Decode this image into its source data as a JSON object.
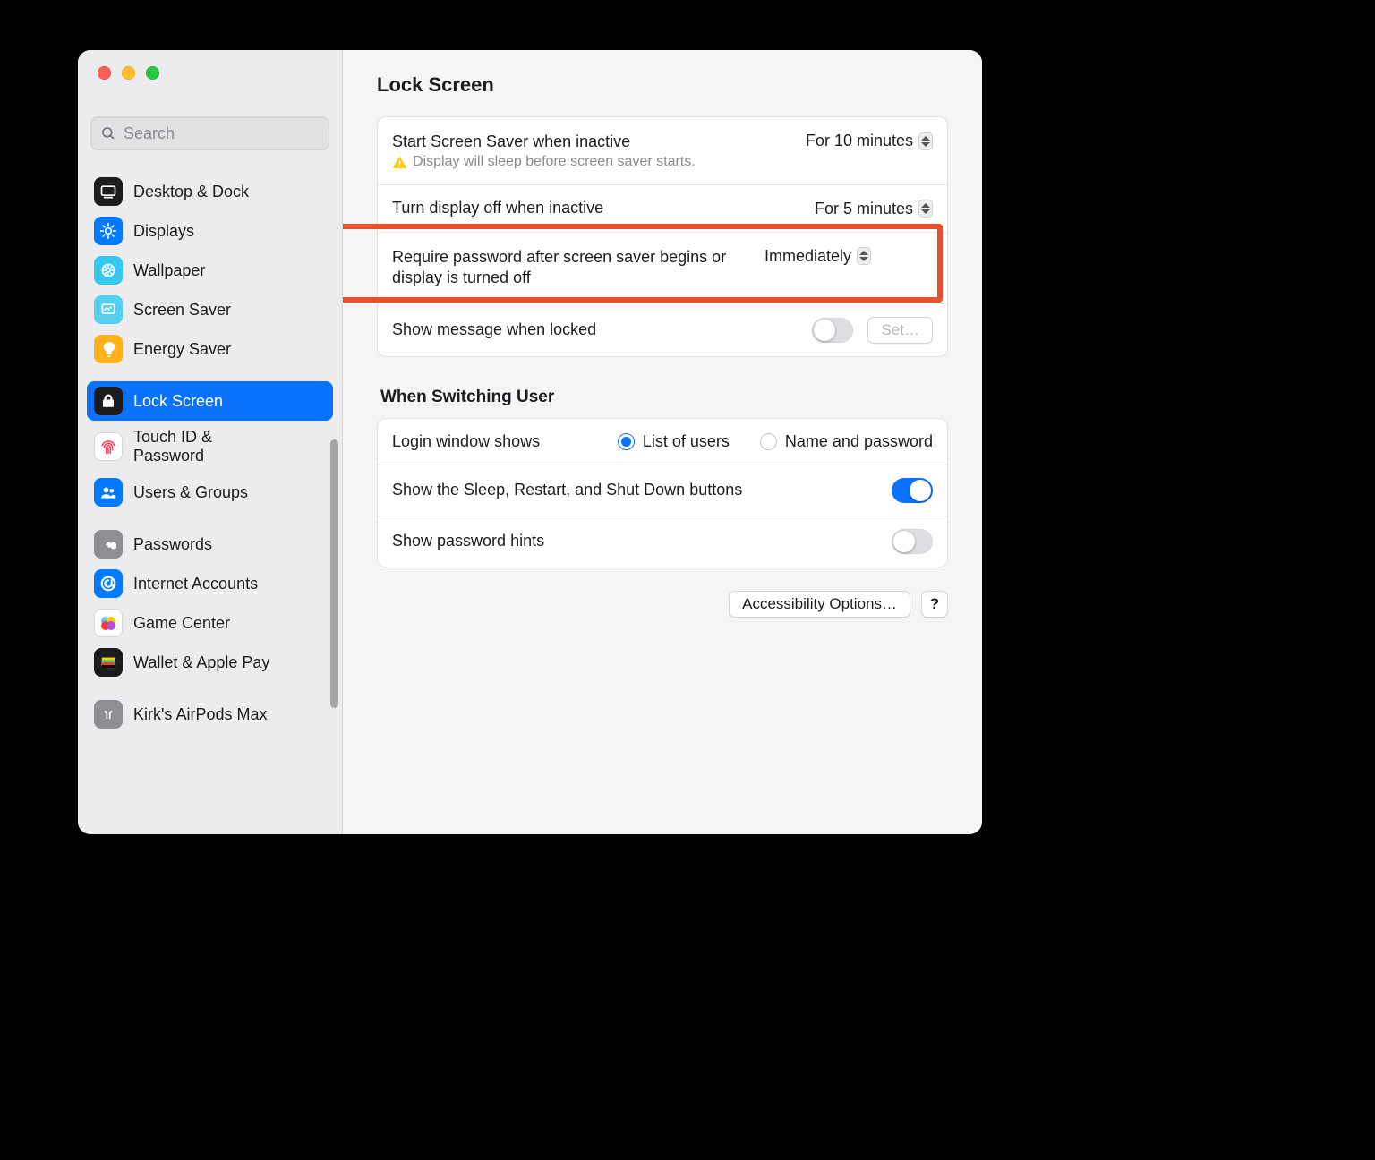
{
  "page_title": "Lock Screen",
  "search_placeholder": "Search",
  "sidebar": {
    "groups": [
      [
        {
          "key": "desktop-dock",
          "label": "Desktop & Dock"
        },
        {
          "key": "displays",
          "label": "Displays"
        },
        {
          "key": "wallpaper",
          "label": "Wallpaper"
        },
        {
          "key": "screensaver",
          "label": "Screen Saver"
        },
        {
          "key": "energy-saver",
          "label": "Energy Saver"
        }
      ],
      [
        {
          "key": "lock-screen",
          "label": "Lock Screen",
          "selected": true
        },
        {
          "key": "touch-id",
          "label": "Touch ID & Password",
          "multiline": true
        },
        {
          "key": "users-groups",
          "label": "Users & Groups"
        }
      ],
      [
        {
          "key": "passwords",
          "label": "Passwords"
        },
        {
          "key": "internet-accounts",
          "label": "Internet Accounts"
        },
        {
          "key": "game-center",
          "label": "Game Center"
        },
        {
          "key": "wallet-apple-pay",
          "label": "Wallet & Apple Pay"
        }
      ],
      [
        {
          "key": "airpods",
          "label": "Kirk's AirPods Max"
        }
      ]
    ]
  },
  "settings": {
    "screensaver_inactive": {
      "label": "Start Screen Saver when inactive",
      "value": "For 10 minutes",
      "warning": "Display will sleep before screen saver starts."
    },
    "display_off": {
      "label": "Turn display off when inactive",
      "value": "For 5 minutes"
    },
    "require_password": {
      "label": "Require password after screen saver begins or display is turned off",
      "value": "Immediately"
    },
    "show_message": {
      "label": "Show message when locked",
      "on": false,
      "set_button": "Set…"
    }
  },
  "switching_user": {
    "heading": "When Switching User",
    "login_window_label": "Login window shows",
    "radios": {
      "list": "List of users",
      "name_pwd": "Name and password",
      "selected": "list"
    },
    "sleep_restart": {
      "label": "Show the Sleep, Restart, and Shut Down buttons",
      "on": true
    },
    "password_hints": {
      "label": "Show password hints",
      "on": false
    }
  },
  "footer": {
    "accessibility": "Accessibility Options…",
    "help": "?"
  }
}
